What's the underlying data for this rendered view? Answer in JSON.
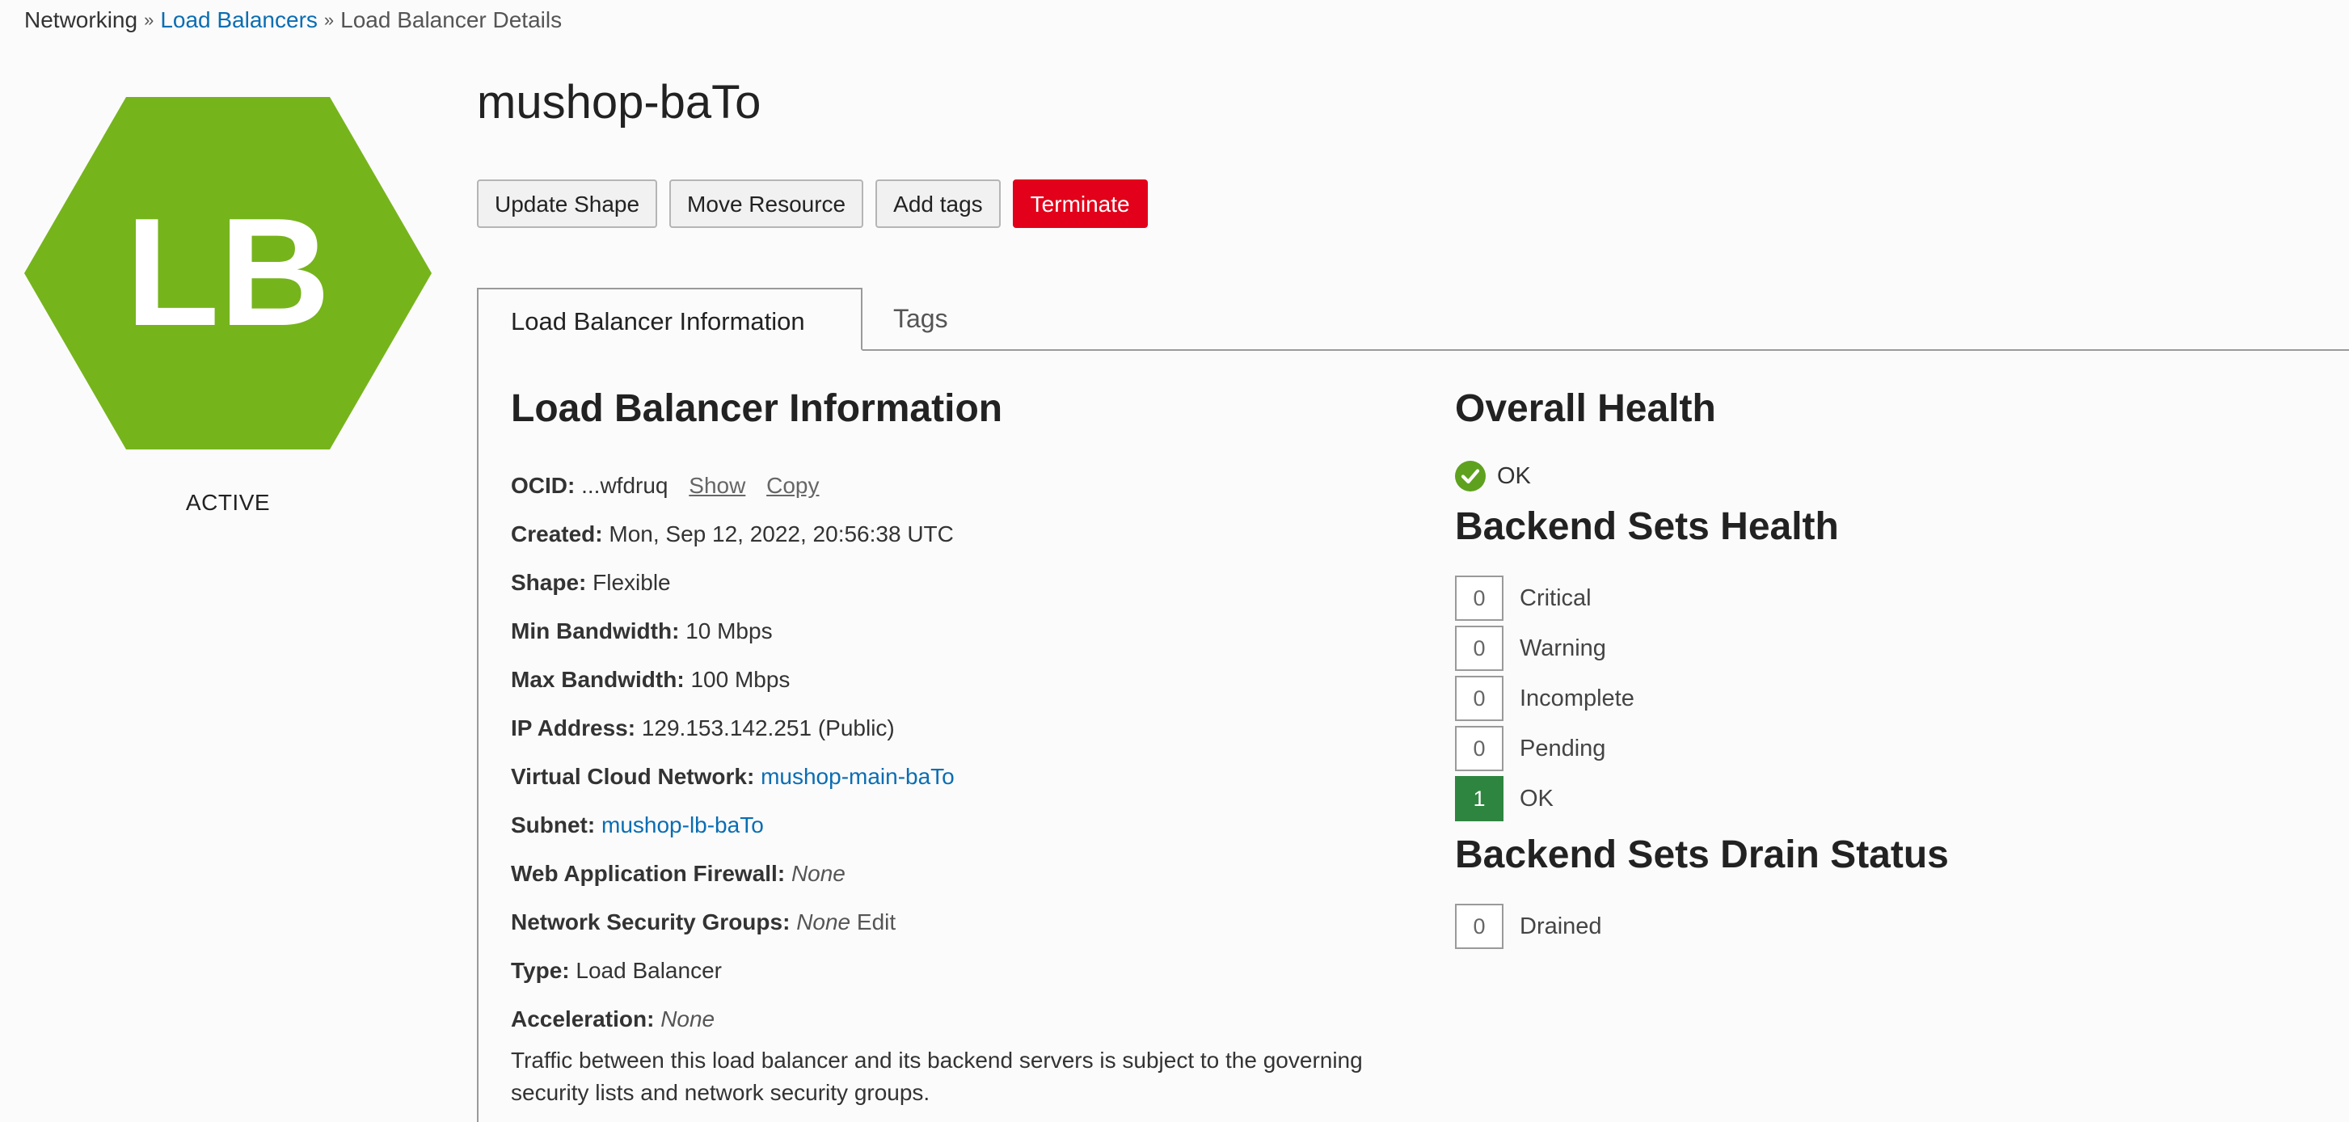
{
  "breadcrumb": {
    "item1": "Networking",
    "item2": "Load Balancers",
    "current": "Load Balancer Details",
    "separator": "»"
  },
  "resource": {
    "badge_text": "LB",
    "badge_color": "#76b41c",
    "state": "ACTIVE",
    "name": "mushop-baTo"
  },
  "actions": {
    "update_shape": "Update Shape",
    "move_resource": "Move Resource",
    "add_tags": "Add tags",
    "terminate": "Terminate"
  },
  "tabs": {
    "info": "Load Balancer Information",
    "tags": "Tags"
  },
  "info": {
    "title": "Load Balancer Information",
    "ocid": {
      "label": "OCID:",
      "value": "...wfdruq",
      "show": "Show",
      "copy": "Copy"
    },
    "created": {
      "label": "Created:",
      "value": "Mon, Sep 12, 2022, 20:56:38 UTC"
    },
    "shape": {
      "label": "Shape:",
      "value": "Flexible"
    },
    "min_bw": {
      "label": "Min Bandwidth:",
      "value": "10 Mbps"
    },
    "max_bw": {
      "label": "Max Bandwidth:",
      "value": "100 Mbps"
    },
    "ip": {
      "label": "IP Address:",
      "value": "129.153.142.251 (Public)"
    },
    "vcn": {
      "label": "Virtual Cloud Network:",
      "value": "mushop-main-baTo"
    },
    "subnet": {
      "label": "Subnet:",
      "value": "mushop-lb-baTo"
    },
    "waf": {
      "label": "Web Application Firewall:",
      "value": "None"
    },
    "nsg": {
      "label": "Network Security Groups:",
      "value": "None",
      "edit": "Edit"
    },
    "type": {
      "label": "Type:",
      "value": "Load Balancer"
    },
    "accel": {
      "label": "Acceleration:",
      "value": "None"
    },
    "note": "Traffic between this load balancer and its backend servers is subject to the governing security lists and network security groups."
  },
  "health": {
    "overall_title": "Overall Health",
    "overall_status": "OK",
    "backend_title": "Backend Sets Health",
    "backend": [
      {
        "count": "0",
        "label": "Critical"
      },
      {
        "count": "0",
        "label": "Warning"
      },
      {
        "count": "0",
        "label": "Incomplete"
      },
      {
        "count": "0",
        "label": "Pending"
      },
      {
        "count": "1",
        "label": "OK"
      }
    ],
    "drain_title": "Backend Sets Drain Status",
    "drain": {
      "count": "0",
      "label": "Drained"
    }
  }
}
